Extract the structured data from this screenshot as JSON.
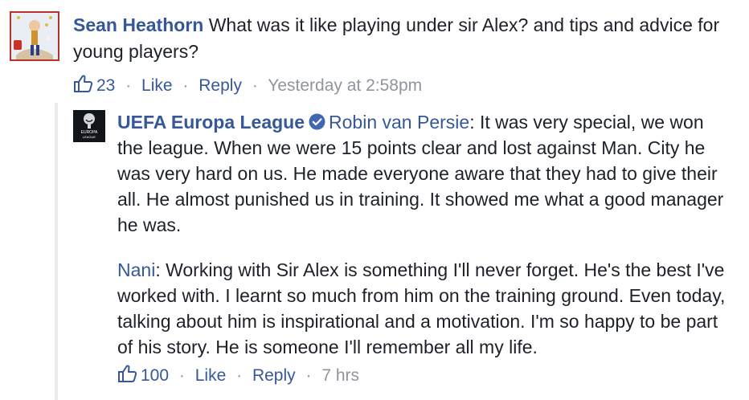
{
  "top_comment": {
    "author": "Sean Heathorn",
    "text": "What was it like playing under sir Alex? and tips and advice for young players?",
    "like_count": "23",
    "like_label": "Like",
    "reply_label": "Reply",
    "timestamp": "Yesterday at 2:58pm",
    "avatar_icon": "user-avatar-photo-icon"
  },
  "reply": {
    "author": "UEFA Europa League",
    "verified_icon": "verified-badge-icon",
    "avatar_icon": "uefa-europa-league-logo-icon",
    "avatar_text_1": "EUROPA",
    "avatar_text_2": "LEAGUE",
    "paragraph1_mention": "Robin van Persie",
    "paragraph1_text": ": It was very special, we won the league. When we were 15 points clear and lost against Man. City he was very hard on us. He made everyone aware that they had to give their all. He almost punished us in training. It showed me what a good manager he was.",
    "paragraph2_mention": "Nani",
    "paragraph2_text": ": Working with Sir Alex is something I'll never forget. He's the best I've worked with. I learnt so much from him on the training ground. Even today, talking about him is inspirational and a motivation. I'm so happy to be part of his story. He is someone I'll remember all my life.",
    "like_count": "100",
    "like_label": "Like",
    "reply_label": "Reply",
    "timestamp": "7 hrs"
  },
  "ui": {
    "separator": "·",
    "link_color": "#365899",
    "meta_color": "#90949c",
    "text_color": "#1d2129"
  }
}
